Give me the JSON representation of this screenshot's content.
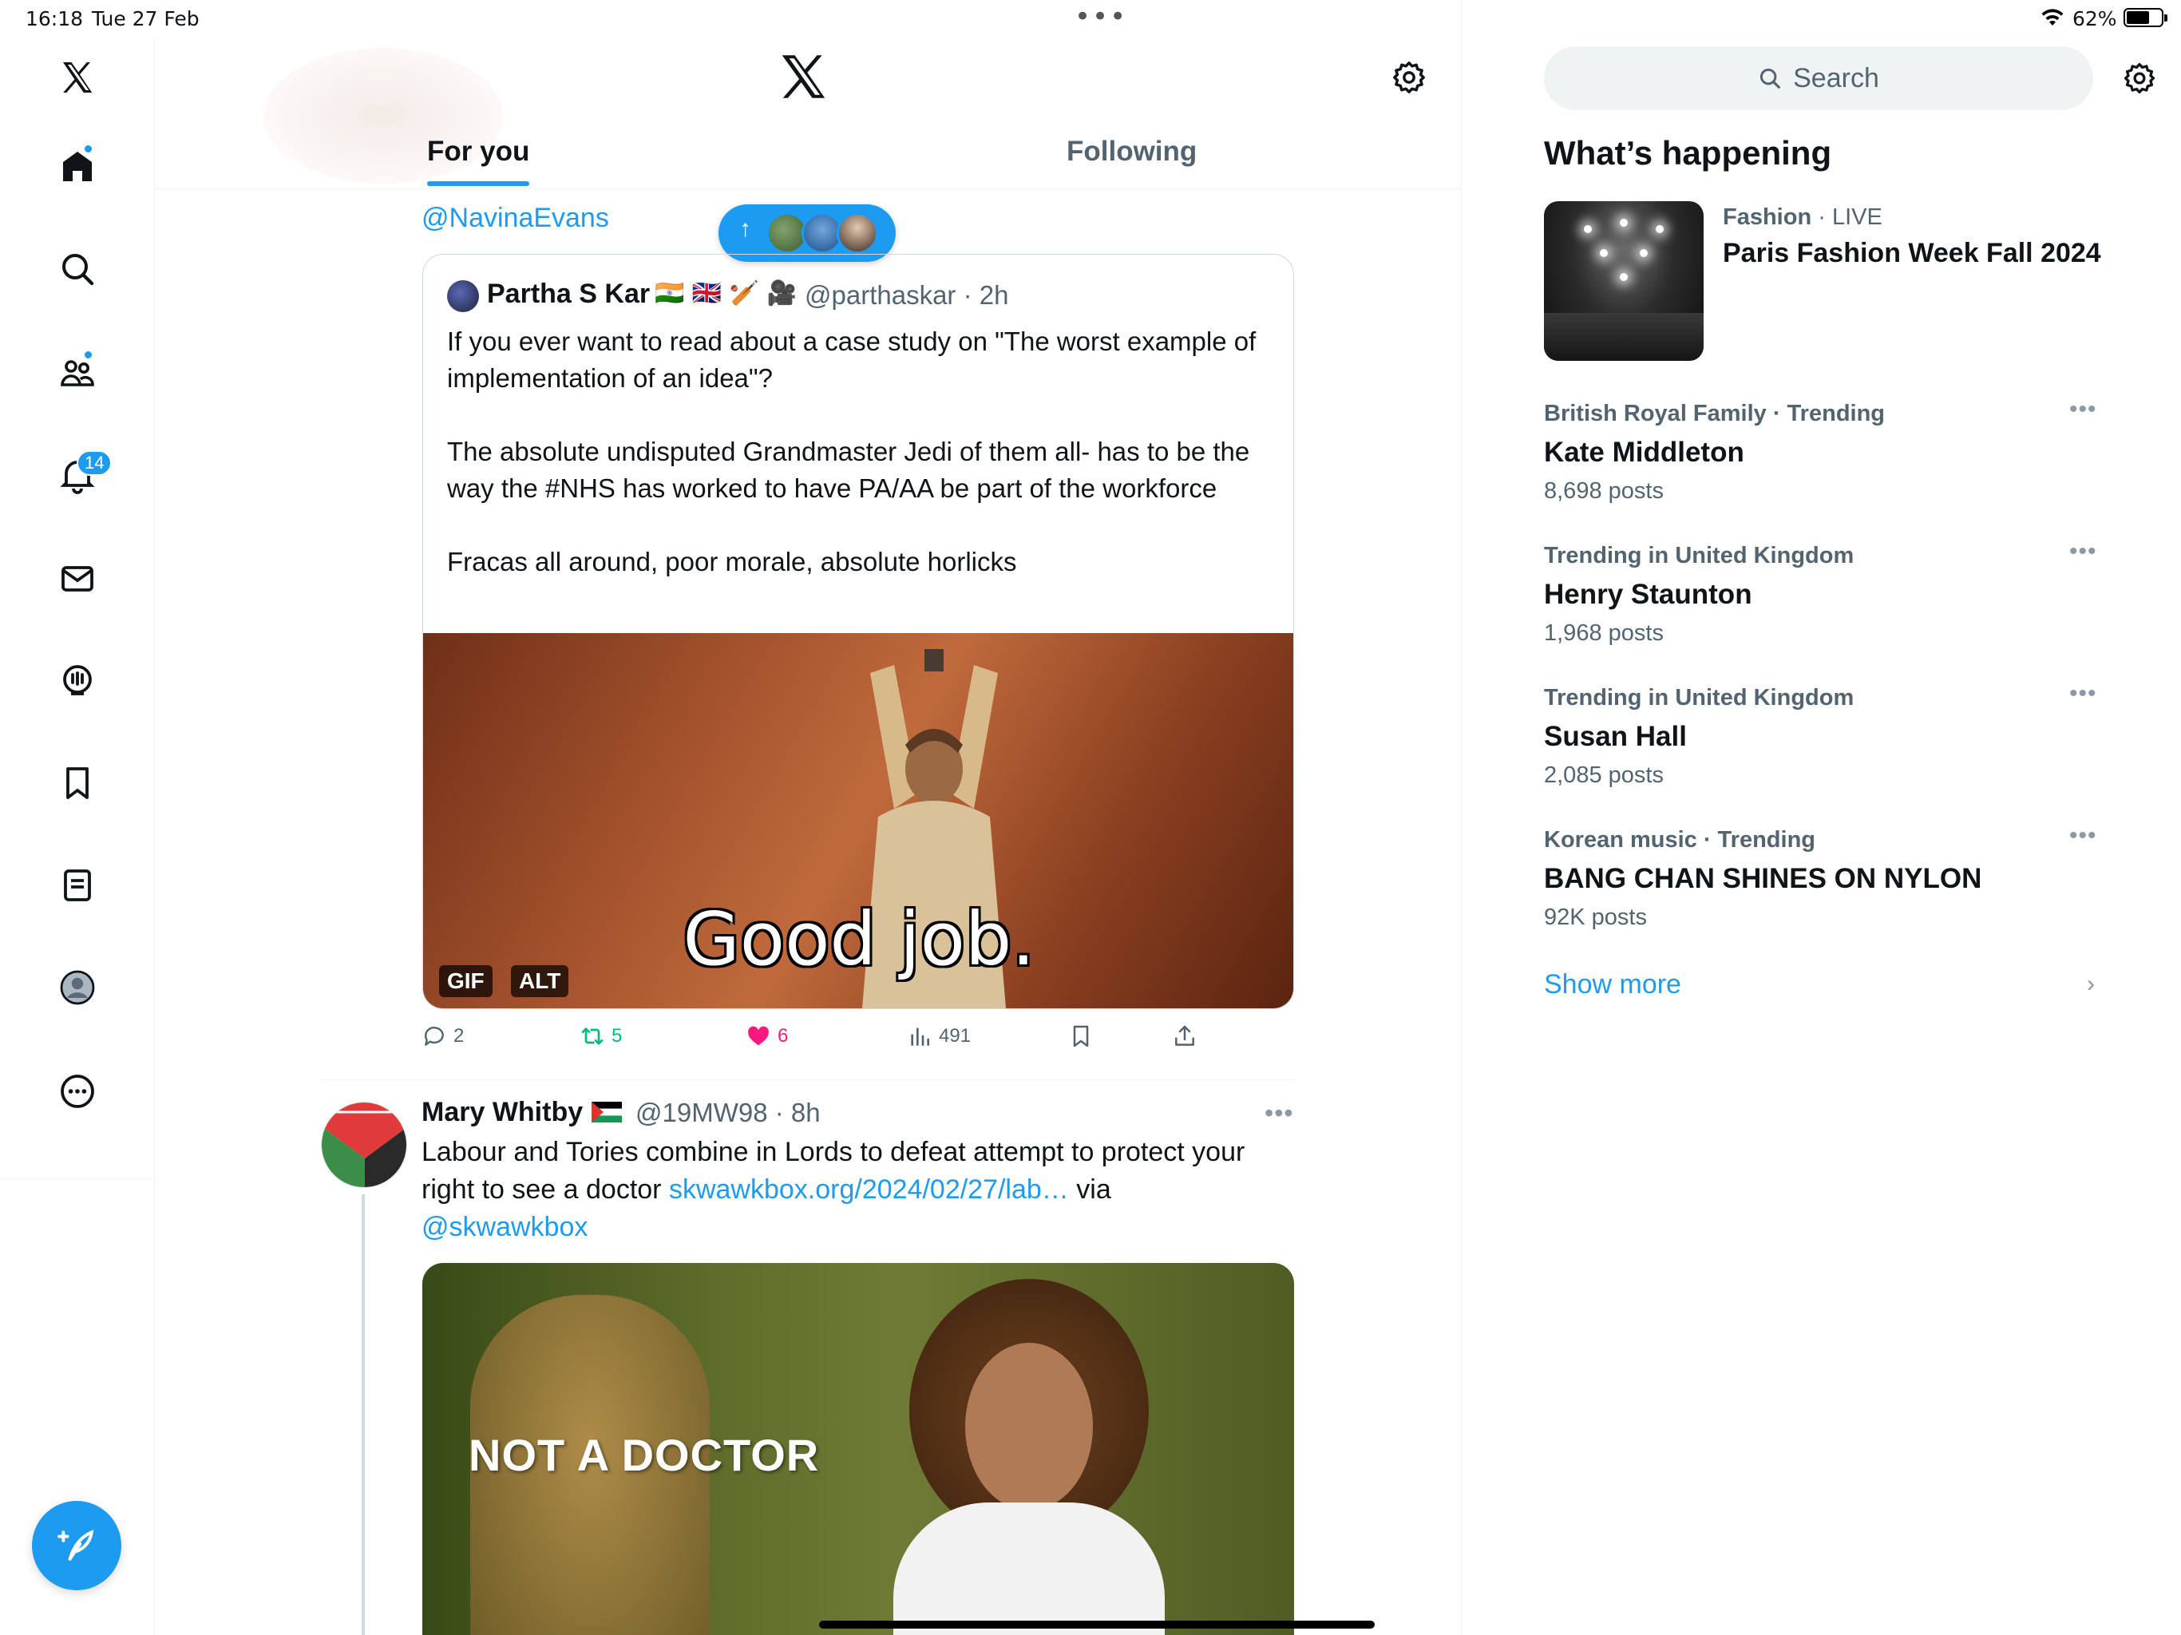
{
  "status_bar": {
    "time": "16:18",
    "date": "Tue 27 Feb",
    "battery": "62%",
    "battery_level": 0.62
  },
  "nav": {
    "items": [
      "x-logo-icon",
      "home-icon",
      "explore-icon",
      "communities-icon",
      "notifications-icon",
      "messages-icon",
      "spaces-icon",
      "bookmarks-icon",
      "lists-icon",
      "profile-icon",
      "more-icon"
    ],
    "notification_count": "14",
    "compose": "compose-icon"
  },
  "header": {
    "tab_for_you": "For you",
    "tab_following": "Following"
  },
  "feed": {
    "mention_top": "@NavinaEvans",
    "quoted": {
      "name": "Partha S Kar",
      "flags": "🇮🇳 🇬🇧 🏏 🎥",
      "handle": "@parthaskar",
      "time": "2h",
      "text": "If you ever want to read about a case study on \"The worst example of implementation of an idea\"?\n\nThe absolute undisputed Grandmaster Jedi of them all- has to be the way the #NHS has worked to have PA/AA be part of the workforce\n\nFracas all around, poor morale, absolute horlicks",
      "media_caption": "Good job.",
      "badge_gif": "GIF",
      "badge_alt": "ALT"
    },
    "actions": {
      "replies": "2",
      "retweets": "5",
      "likes": "6",
      "views": "491"
    },
    "tweet2": {
      "name": "Mary Whitby",
      "handle": "@19MW98",
      "time": "8h",
      "text_main": "Labour and Tories combine in Lords to defeat attempt to protect your right to see a doctor ",
      "link": "skwawkbox.org/2024/02/27/lab…",
      "text_via": " via",
      "mention": "@skwawkbox",
      "media_text": "NOT A DOCTOR"
    }
  },
  "sidebar": {
    "search_placeholder": "Search",
    "title": "What’s happening",
    "featured": {
      "category": "Fashion",
      "live": "LIVE",
      "title": "Paris Fashion Week Fall 2024"
    },
    "trends": [
      {
        "meta": "British Royal Family · Trending",
        "name": "Kate Middleton",
        "posts": "8,698 posts"
      },
      {
        "meta": "Trending in United Kingdom",
        "name": "Henry Staunton",
        "posts": "1,968 posts"
      },
      {
        "meta": "Trending in United Kingdom",
        "name": "Susan Hall",
        "posts": "2,085 posts"
      },
      {
        "meta": "Korean music · Trending",
        "name": "BANG CHAN SHINES ON NYLON",
        "posts": "92K posts"
      }
    ],
    "show_more": "Show more"
  },
  "colors": {
    "accent": "#1d9bf0",
    "text": "#0f1419",
    "secondary": "#536471",
    "like": "#f91880",
    "retweet": "#00ba7c"
  }
}
